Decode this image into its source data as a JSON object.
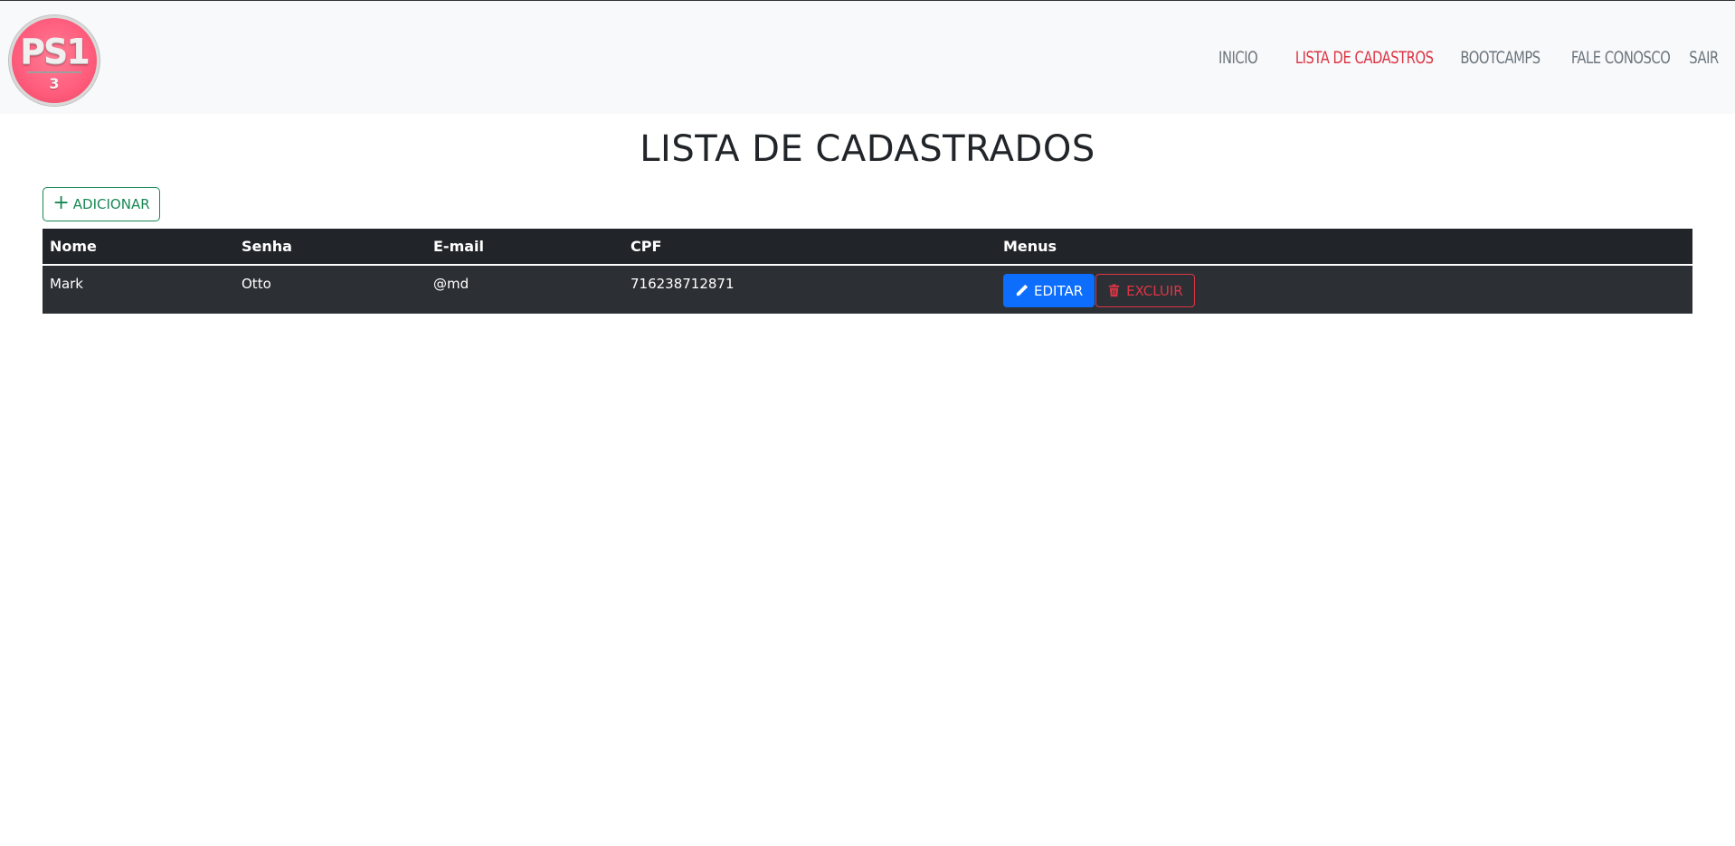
{
  "header": {
    "logo": {
      "main": "PS1",
      "sub": "3"
    },
    "nav": [
      {
        "label": "INICIO",
        "active": false
      },
      {
        "label": "LISTA DE CADASTROS",
        "active": true
      },
      {
        "label": "BOOTCAMPS",
        "active": false
      },
      {
        "label": "FALE CONOSCO",
        "active": false
      },
      {
        "label": "SAIR",
        "active": false
      }
    ]
  },
  "page": {
    "title": "LISTA DE CADASTRADOS",
    "add_button": "ADICIONAR"
  },
  "table": {
    "headers": [
      "Nome",
      "Senha",
      "E-mail",
      "CPF",
      "Menus"
    ],
    "rows": [
      {
        "nome": "Mark",
        "senha": "Otto",
        "email": "@md",
        "cpf": "716238712871"
      }
    ],
    "edit_label": "EDITAR",
    "delete_label": "EXCLUIR"
  },
  "colors": {
    "active_nav": "#dc3545",
    "add_button": "#198754",
    "edit_button": "#0d6efd",
    "delete_button": "#dc3545",
    "table_bg": "#212529"
  }
}
